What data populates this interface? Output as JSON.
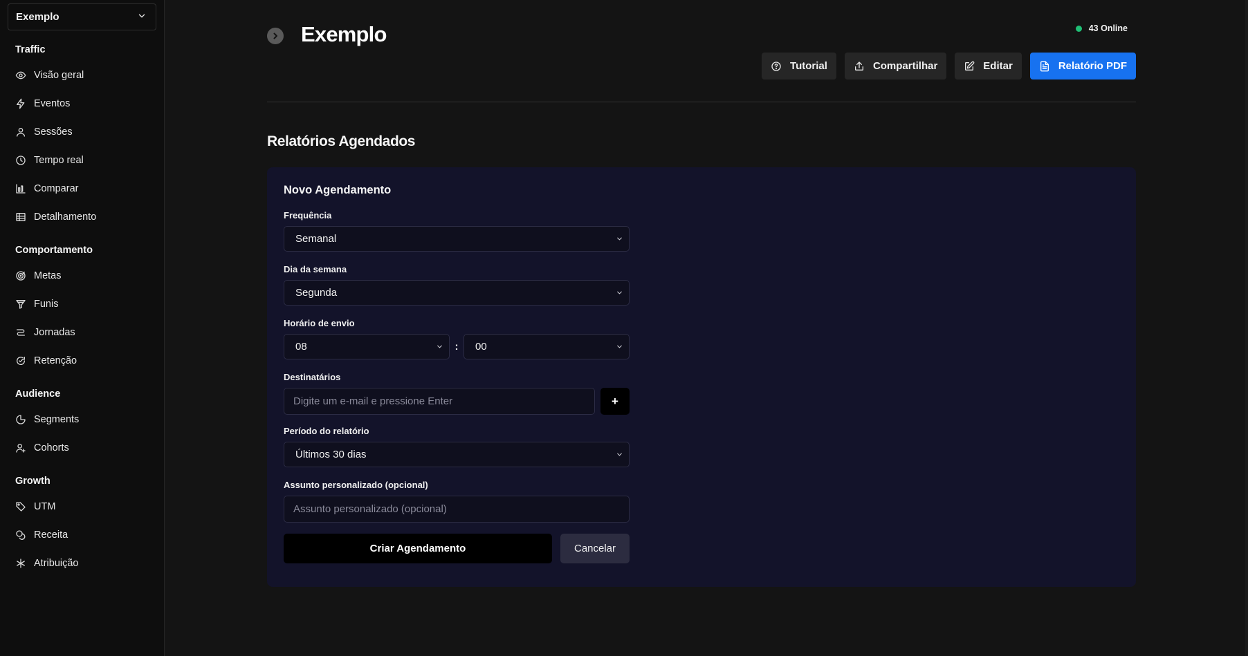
{
  "sidebar": {
    "site_selector": {
      "value": "Exemplo"
    },
    "sections": [
      {
        "title": "Traffic",
        "items": [
          {
            "label": "Visão geral",
            "icon": "eye-icon"
          },
          {
            "label": "Eventos",
            "icon": "lightning-icon"
          },
          {
            "label": "Sessões",
            "icon": "user-icon"
          },
          {
            "label": "Tempo real",
            "icon": "clock-icon"
          },
          {
            "label": "Comparar",
            "icon": "bar-chart-icon"
          },
          {
            "label": "Detalhamento",
            "icon": "table-icon"
          }
        ]
      },
      {
        "title": "Comportamento",
        "items": [
          {
            "label": "Metas",
            "icon": "target-icon"
          },
          {
            "label": "Funis",
            "icon": "funnel-icon"
          },
          {
            "label": "Jornadas",
            "icon": "route-icon"
          },
          {
            "label": "Retenção",
            "icon": "retention-icon"
          }
        ]
      },
      {
        "title": "Audience",
        "items": [
          {
            "label": "Segments",
            "icon": "pie-icon"
          },
          {
            "label": "Cohorts",
            "icon": "user-plus-icon"
          }
        ]
      },
      {
        "title": "Growth",
        "items": [
          {
            "label": "UTM",
            "icon": "tag-icon"
          },
          {
            "label": "Receita",
            "icon": "coins-icon"
          },
          {
            "label": "Atribuição",
            "icon": "asterisk-icon"
          }
        ]
      }
    ]
  },
  "header": {
    "title": "Exemplo",
    "online_count": "43 Online",
    "online_color": "#1fbf75",
    "actions": {
      "tutorial": "Tutorial",
      "share": "Compartilhar",
      "edit": "Editar",
      "pdf": "Relatório PDF"
    }
  },
  "main": {
    "section_title": "Relatórios Agendados",
    "form": {
      "title": "Novo Agendamento",
      "frequency": {
        "label": "Frequência",
        "value": "Semanal"
      },
      "weekday": {
        "label": "Dia da semana",
        "value": "Segunda"
      },
      "send_time": {
        "label": "Horário de envio",
        "hour": "08",
        "separator": ":",
        "minute": "00"
      },
      "recipients": {
        "label": "Destinatários",
        "placeholder": "Digite um e-mail e pressione Enter",
        "add_label": "+"
      },
      "period": {
        "label": "Período do relatório",
        "value": "Últimos 30 dias"
      },
      "subject": {
        "label": "Assunto personalizado (opcional)",
        "placeholder": "Assunto personalizado (opcional)"
      },
      "submit_label": "Criar Agendamento",
      "cancel_label": "Cancelar"
    }
  },
  "colors": {
    "accent": "#1772f0",
    "card_bg": "#13132a",
    "page_bg": "#141414"
  }
}
